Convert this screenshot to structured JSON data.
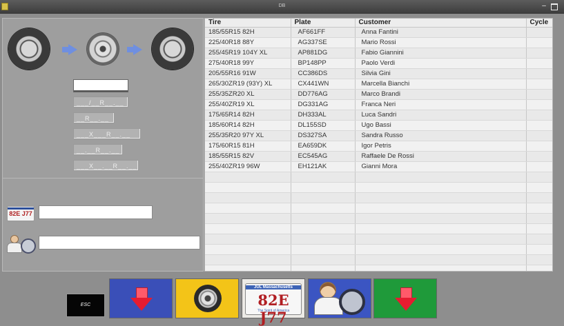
{
  "window": {
    "title": "DB",
    "minimize_glyph": "–",
    "icon": "app-icon"
  },
  "format_patterns": [
    "___/__R__.__",
    "__R__.__",
    "___X___R__.__",
    "__.__R__.__",
    "___X__.__R__.__"
  ],
  "search": {
    "plate_value": "",
    "customer_value": ""
  },
  "icons": {
    "plate_small": "82E J77",
    "big_plate_state": "JUL  Massachusetts",
    "big_plate_number": "82E J77",
    "big_plate_motto": "The Spirit of America"
  },
  "table": {
    "columns": [
      "Tire",
      "Plate",
      "Customer",
      "Cycle"
    ],
    "rows": [
      [
        "185/55R15 82H",
        "AF661FF",
        "Anna Fantini",
        ""
      ],
      [
        "225/40R18 88Y",
        "AG337SE",
        "Mario Rossi",
        ""
      ],
      [
        "255/45R19 104Y XL",
        "AP881DG",
        "Fabio Giannini",
        ""
      ],
      [
        "275/40R18 99Y",
        "BP148PP",
        "Paolo Verdi",
        ""
      ],
      [
        "205/55R16 91W",
        "CC386DS",
        "Silvia Gini",
        ""
      ],
      [
        "265/30ZR19 (93Y) XL",
        "CX441WN",
        "Marcella Bianchi",
        ""
      ],
      [
        "255/35ZR20 XL",
        "DD776AG",
        "Marco Brandi",
        ""
      ],
      [
        "255/40ZR19 XL",
        "DG331AG",
        "Franca Neri",
        ""
      ],
      [
        "175/65R14 82H",
        "DH333AL",
        "Luca Sandri",
        ""
      ],
      [
        "185/60R14 82H",
        "DL155SD",
        "Ugo Bassi",
        ""
      ],
      [
        "255/35R20 97Y XL",
        "DS327SA",
        "Sandra Russo",
        ""
      ],
      [
        "175/60R15 81H",
        "EA659DK",
        "Igor Petris",
        ""
      ],
      [
        "185/55R15 82V",
        "EC545AG",
        "Raffaele De Rossi",
        ""
      ],
      [
        "255/40ZR19 96W",
        "EH121AK",
        "Gianni Mora",
        ""
      ],
      [
        "",
        "",
        "",
        ""
      ],
      [
        "",
        "",
        "",
        ""
      ],
      [
        "",
        "",
        "",
        ""
      ],
      [
        "",
        "",
        "",
        ""
      ],
      [
        "",
        "",
        "",
        ""
      ],
      [
        "",
        "",
        "",
        ""
      ],
      [
        "",
        "",
        "",
        ""
      ],
      [
        "",
        "",
        "",
        ""
      ],
      [
        "",
        "",
        "",
        ""
      ],
      [
        "",
        "",
        "",
        ""
      ]
    ]
  },
  "toolbar": {
    "esc_label": "ESC"
  },
  "colors": {
    "accent_blue": "#3a4fb8",
    "accent_yellow": "#f3c418",
    "accent_green": "#1f9a3a",
    "arrow_red": "#e51c30"
  }
}
